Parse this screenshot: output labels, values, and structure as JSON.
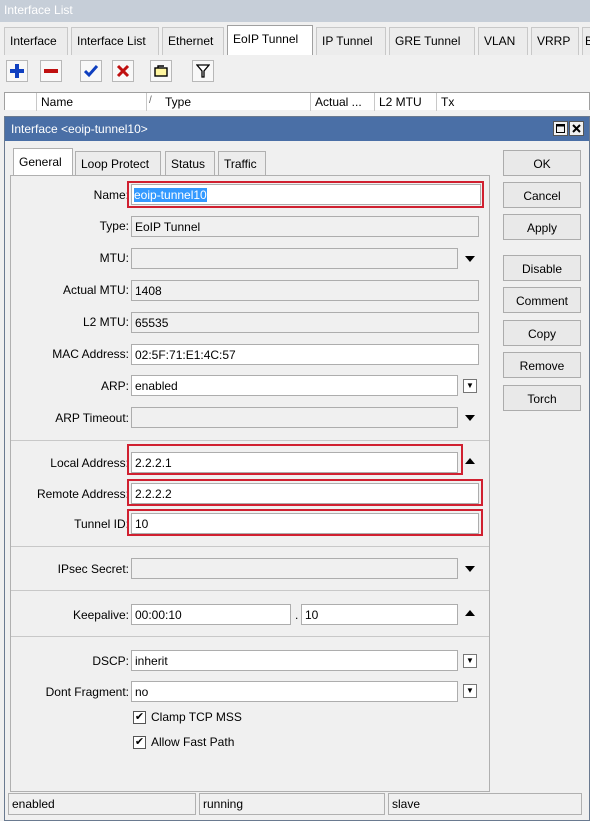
{
  "window": {
    "title": "Interface List"
  },
  "outer_tabs": [
    "Interface",
    "Interface List",
    "Ethernet",
    "EoIP Tunnel",
    "IP Tunnel",
    "GRE Tunnel",
    "VLAN",
    "VRRP",
    "B"
  ],
  "toolbar": {
    "icons": [
      "add-icon",
      "remove-icon",
      "enable-icon",
      "disable-icon",
      "comment-icon",
      "filter-icon"
    ],
    "colors": {
      "add": "#1040c0",
      "remove": "#c01010",
      "enable": "#1040c0",
      "disable": "#c01010"
    }
  },
  "columns": [
    "Name",
    "/",
    "Type",
    "Actual ...",
    "L2 MTU",
    "Tx"
  ],
  "dialog": {
    "title": "Interface <eoip-tunnel10>",
    "tabs": [
      "General",
      "Loop Protect",
      "Status",
      "Traffic"
    ],
    "fields": {
      "name": {
        "label": "Name:",
        "value": "eoip-tunnel10"
      },
      "type": {
        "label": "Type:",
        "value": "EoIP Tunnel"
      },
      "mtu": {
        "label": "MTU:",
        "value": ""
      },
      "actual_mtu": {
        "label": "Actual MTU:",
        "value": "1408"
      },
      "l2_mtu": {
        "label": "L2 MTU:",
        "value": "65535"
      },
      "mac": {
        "label": "MAC Address:",
        "value": "02:5F:71:E1:4C:57"
      },
      "arp": {
        "label": "ARP:",
        "value": "enabled"
      },
      "arp_timeout": {
        "label": "ARP Timeout:",
        "value": ""
      },
      "local_address": {
        "label": "Local Address:",
        "value": "2.2.2.1"
      },
      "remote_address": {
        "label": "Remote Address:",
        "value": "2.2.2.2"
      },
      "tunnel_id": {
        "label": "Tunnel ID:",
        "value": "10"
      },
      "ipsec_secret": {
        "label": "IPsec Secret:",
        "value": ""
      },
      "keepalive": {
        "label": "Keepalive:",
        "value": "00:00:10",
        "dot": ".",
        "value2": "10"
      },
      "dscp": {
        "label": "DSCP:",
        "value": "inherit"
      },
      "dont_fragment": {
        "label": "Dont Fragment:",
        "value": "no"
      }
    },
    "checkboxes": [
      {
        "label": "Clamp TCP MSS",
        "checked": true
      },
      {
        "label": "Allow Fast Path",
        "checked": true
      }
    ],
    "buttons": [
      "OK",
      "Cancel",
      "Apply",
      "Disable",
      "Comment",
      "Copy",
      "Remove",
      "Torch"
    ],
    "status": [
      "enabled",
      "running",
      "slave"
    ],
    "highlight_color": "#d02030"
  }
}
